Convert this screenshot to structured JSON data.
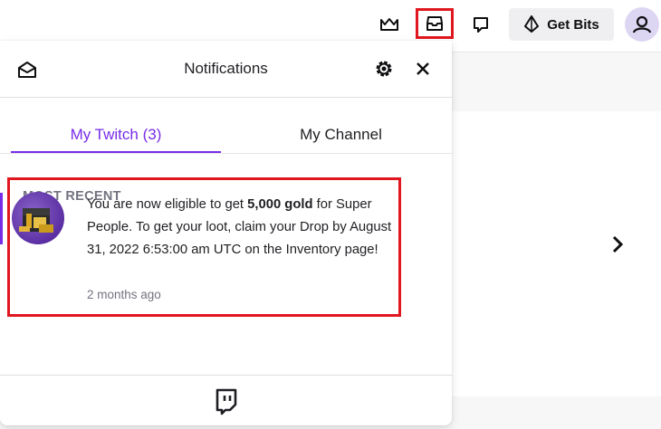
{
  "topbar": {
    "get_bits_label": "Get Bits",
    "icons": [
      "crown-icon",
      "inbox-icon",
      "whisper-icon",
      "bits-icon",
      "user-icon"
    ]
  },
  "panel": {
    "title": "Notifications",
    "tabs": [
      {
        "label": "My Twitch (3)",
        "active": true
      },
      {
        "label": "My Channel",
        "active": false
      }
    ],
    "section_label": "MOST RECENT",
    "notification": {
      "text_part1": "You are now eligible to get ",
      "text_bold": "5,000 gold",
      "text_part2": " for Super People. To get your loot, claim your Drop by August 31, 2022 6:53:00 am UTC on the Inventory page!",
      "time": "2 months ago"
    }
  },
  "colors": {
    "accent": "#772ce8",
    "highlight": "#e0171f",
    "muted": "#737380"
  }
}
